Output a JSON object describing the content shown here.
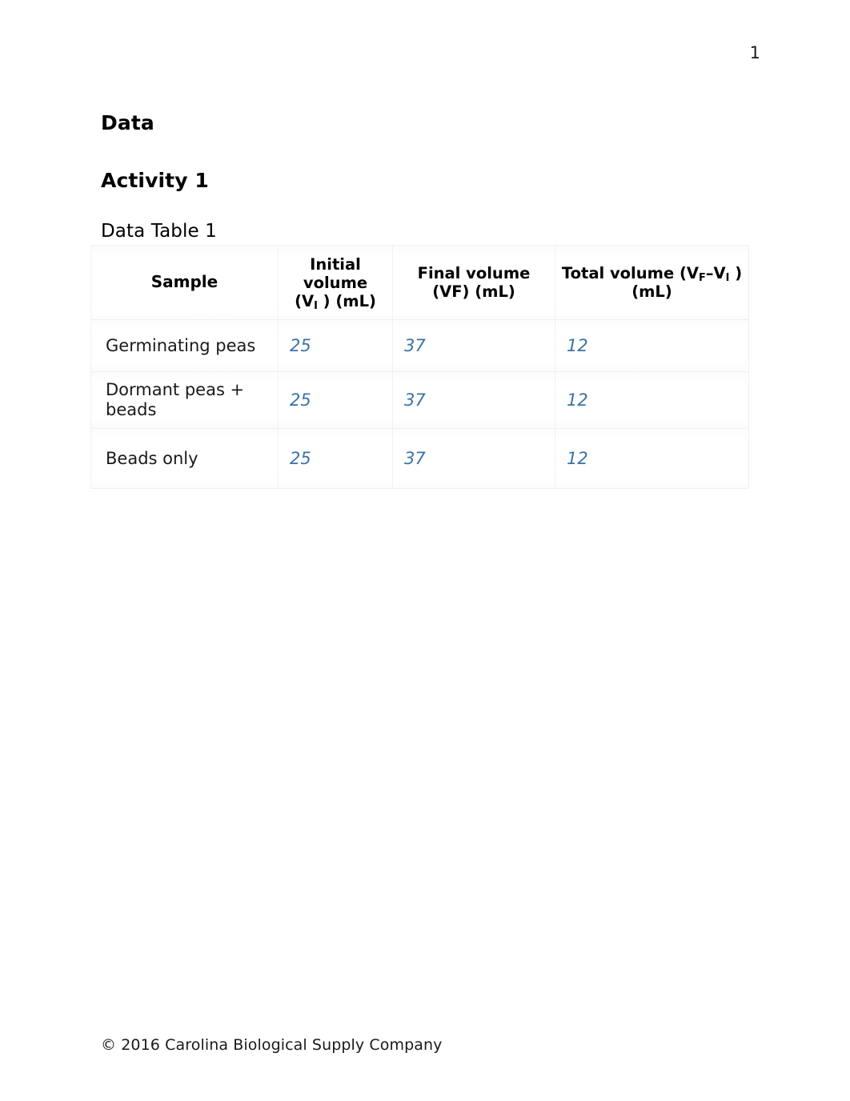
{
  "document": {
    "page_number": "1",
    "headings": {
      "data": "Data",
      "activity": "Activity 1",
      "table_caption": "Data Table 1"
    },
    "footer": "© 2016 Carolina Biological Supply Company",
    "colors": {
      "value_text": "#3b72a8",
      "body_text": "#1a1a1a",
      "table_border": "#f1f1f1"
    }
  },
  "table": {
    "name": "Data Table 1",
    "headers": {
      "sample": "Sample",
      "initial_volume_line1": "Initial",
      "initial_volume_line2": "volume",
      "initial_volume_line3_pre": "(V",
      "initial_volume_line3_sub": "I",
      "initial_volume_line3_post": " ) (mL)",
      "final_volume_line1": "Final volume",
      "final_volume_line2": "(VF) (mL)",
      "total_volume_pre": "Total volume (V",
      "total_volume_sub1": "F",
      "total_volume_dash": "–",
      "total_volume_mid": "V",
      "total_volume_sub2": "I",
      "total_volume_post": " ) (mL)"
    },
    "header_plain": [
      "Sample",
      "Initial volume (VI ) (mL)",
      "Final volume (VF) (mL)",
      "Total volume (VF–VI ) (mL)"
    ],
    "rows": [
      {
        "sample": "Germinating peas",
        "initial_volume": "25",
        "final_volume": "37",
        "total_volume": "12"
      },
      {
        "sample": "Dormant peas + beads",
        "initial_volume": "25",
        "final_volume": "37",
        "total_volume": "12"
      },
      {
        "sample": "Beads only",
        "initial_volume": "25",
        "final_volume": "37",
        "total_volume": "12"
      }
    ]
  }
}
